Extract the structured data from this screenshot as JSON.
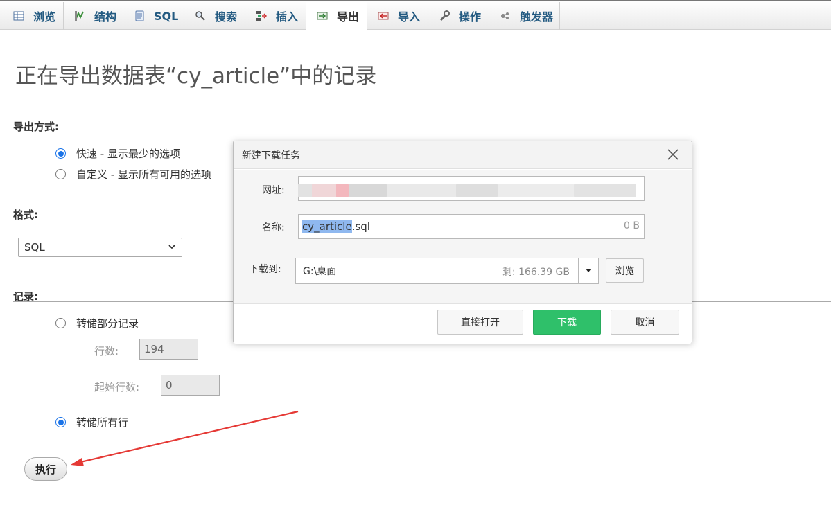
{
  "tabs": [
    {
      "label": "浏览",
      "icon": "table-icon"
    },
    {
      "label": "结构",
      "icon": "structure-icon"
    },
    {
      "label": "SQL",
      "icon": "sql-icon"
    },
    {
      "label": "搜索",
      "icon": "search-icon"
    },
    {
      "label": "插入",
      "icon": "insert-icon"
    },
    {
      "label": "导出",
      "icon": "export-icon",
      "active": true
    },
    {
      "label": "导入",
      "icon": "import-icon"
    },
    {
      "label": "操作",
      "icon": "wrench-icon"
    },
    {
      "label": "触发器",
      "icon": "trigger-icon"
    }
  ],
  "page": {
    "title": "正在导出数据表“cy_article”中的记录"
  },
  "export_method": {
    "heading": "导出方式:",
    "options": [
      {
        "label": "快速 - 显示最少的选项",
        "selected": true
      },
      {
        "label": "自定义 - 显示所有可用的选项",
        "selected": false
      }
    ]
  },
  "format": {
    "heading": "格式:",
    "selected": "SQL"
  },
  "records": {
    "heading": "记录:",
    "partial_label": "转储部分记录",
    "rows_label": "行数:",
    "rows_value": "194",
    "start_label": "起始行数:",
    "start_value": "0",
    "all_label": "转储所有行",
    "all_selected": true
  },
  "execute_label": "执行",
  "dialog": {
    "title": "新建下载任务",
    "url_label": "网址:",
    "name_label": "名称:",
    "name_selected": "cy_article",
    "name_rest": ".sql",
    "size": "0 B",
    "saveto_label": "下载到:",
    "path": "G:\\桌面",
    "remaining": "剩: 166.39 GB",
    "browse_label": "浏览",
    "open_label": "直接打开",
    "download_label": "下载",
    "cancel_label": "取消"
  },
  "colors": {
    "accent_blue": "#1a73e8",
    "download_green": "#2fc06a",
    "annotation_red": "#e53935"
  }
}
